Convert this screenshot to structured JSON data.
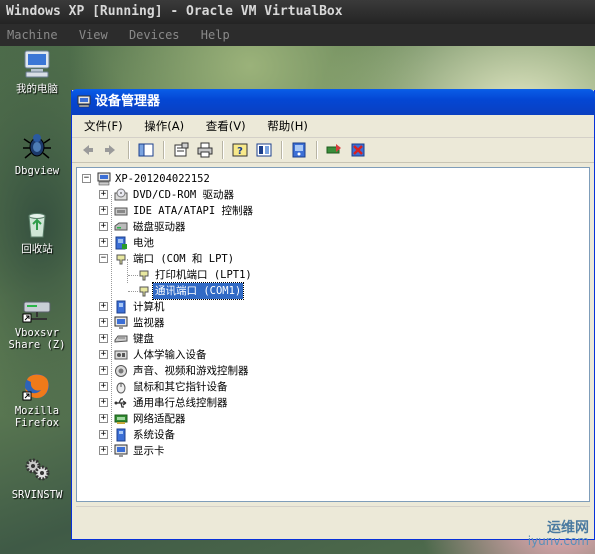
{
  "host": {
    "title": "Windows XP [Running] - Oracle VM VirtualBox",
    "menu": [
      "Machine",
      "View",
      "Devices",
      "Help"
    ]
  },
  "desktop": {
    "icons": [
      {
        "label": "我的电脑",
        "icon": "my-computer-icon"
      },
      {
        "label": "Dbgview",
        "icon": "bug-icon"
      },
      {
        "label": "回收站",
        "icon": "recycle-bin-icon"
      },
      {
        "label": "Vboxsvr Share (Z)",
        "icon": "network-drive-icon"
      },
      {
        "label": "Mozilla Firefox",
        "icon": "firefox-icon"
      },
      {
        "label": "SRVINSTW",
        "icon": "gear-cluster-icon"
      }
    ]
  },
  "window": {
    "title": "设备管理器",
    "menu": [
      "文件(F)",
      "操作(A)",
      "查看(V)",
      "帮助(H)"
    ],
    "toolbar": [
      "back-icon",
      "forward-icon",
      "show-hide-tree-icon",
      "properties-icon",
      "print-icon",
      "help-icon",
      "view-icon",
      "scan-hardware-icon",
      "update-driver-icon",
      "uninstall-icon"
    ],
    "tree": {
      "root": "XP-201204022152",
      "items": [
        {
          "label": "DVD/CD-ROM 驱动器",
          "expanded": false
        },
        {
          "label": "IDE ATA/ATAPI 控制器",
          "expanded": false
        },
        {
          "label": "磁盘驱动器",
          "expanded": false
        },
        {
          "label": "电池",
          "expanded": false
        },
        {
          "label": "端口 (COM 和 LPT)",
          "expanded": true,
          "children": [
            {
              "label": "打印机端口 (LPT1)",
              "selected": false
            },
            {
              "label": "通讯端口 (COM1)",
              "selected": true
            }
          ]
        },
        {
          "label": "计算机",
          "expanded": false
        },
        {
          "label": "监视器",
          "expanded": false
        },
        {
          "label": "键盘",
          "expanded": false
        },
        {
          "label": "人体学输入设备",
          "expanded": false
        },
        {
          "label": "声音、视频和游戏控制器",
          "expanded": false
        },
        {
          "label": "鼠标和其它指针设备",
          "expanded": false
        },
        {
          "label": "通用串行总线控制器",
          "expanded": false
        },
        {
          "label": "网络适配器",
          "expanded": false
        },
        {
          "label": "系统设备",
          "expanded": false
        },
        {
          "label": "显示卡",
          "expanded": false
        }
      ]
    }
  },
  "watermark": {
    "line1": "运维网",
    "line2": "iyunv.com"
  }
}
